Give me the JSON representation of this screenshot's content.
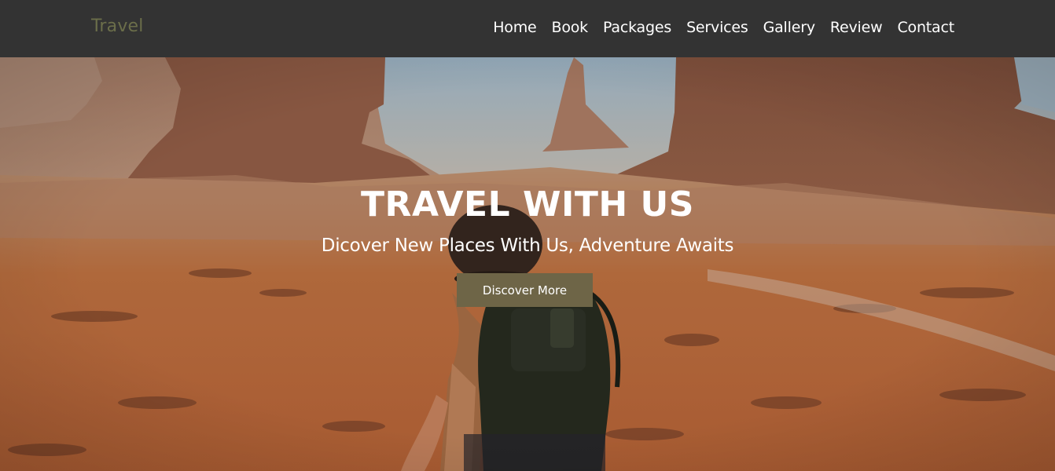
{
  "brand": {
    "name": "Travel",
    "color": "#6b6e4a"
  },
  "nav": {
    "items": [
      {
        "label": "Home"
      },
      {
        "label": "Book"
      },
      {
        "label": "Packages"
      },
      {
        "label": "Services"
      },
      {
        "label": "Gallery"
      },
      {
        "label": "Review"
      },
      {
        "label": "Contact"
      }
    ]
  },
  "hero": {
    "title": "TRAVEL WITH US",
    "subtitle": "Dicover New Places With Us, Adventure Awaits",
    "cta_label": "Discover More",
    "cta_color": "#6e6547",
    "background_image": "desert-canyon-hiker-photo"
  },
  "colors": {
    "header_bg": "#333333",
    "text": "#ffffff"
  }
}
